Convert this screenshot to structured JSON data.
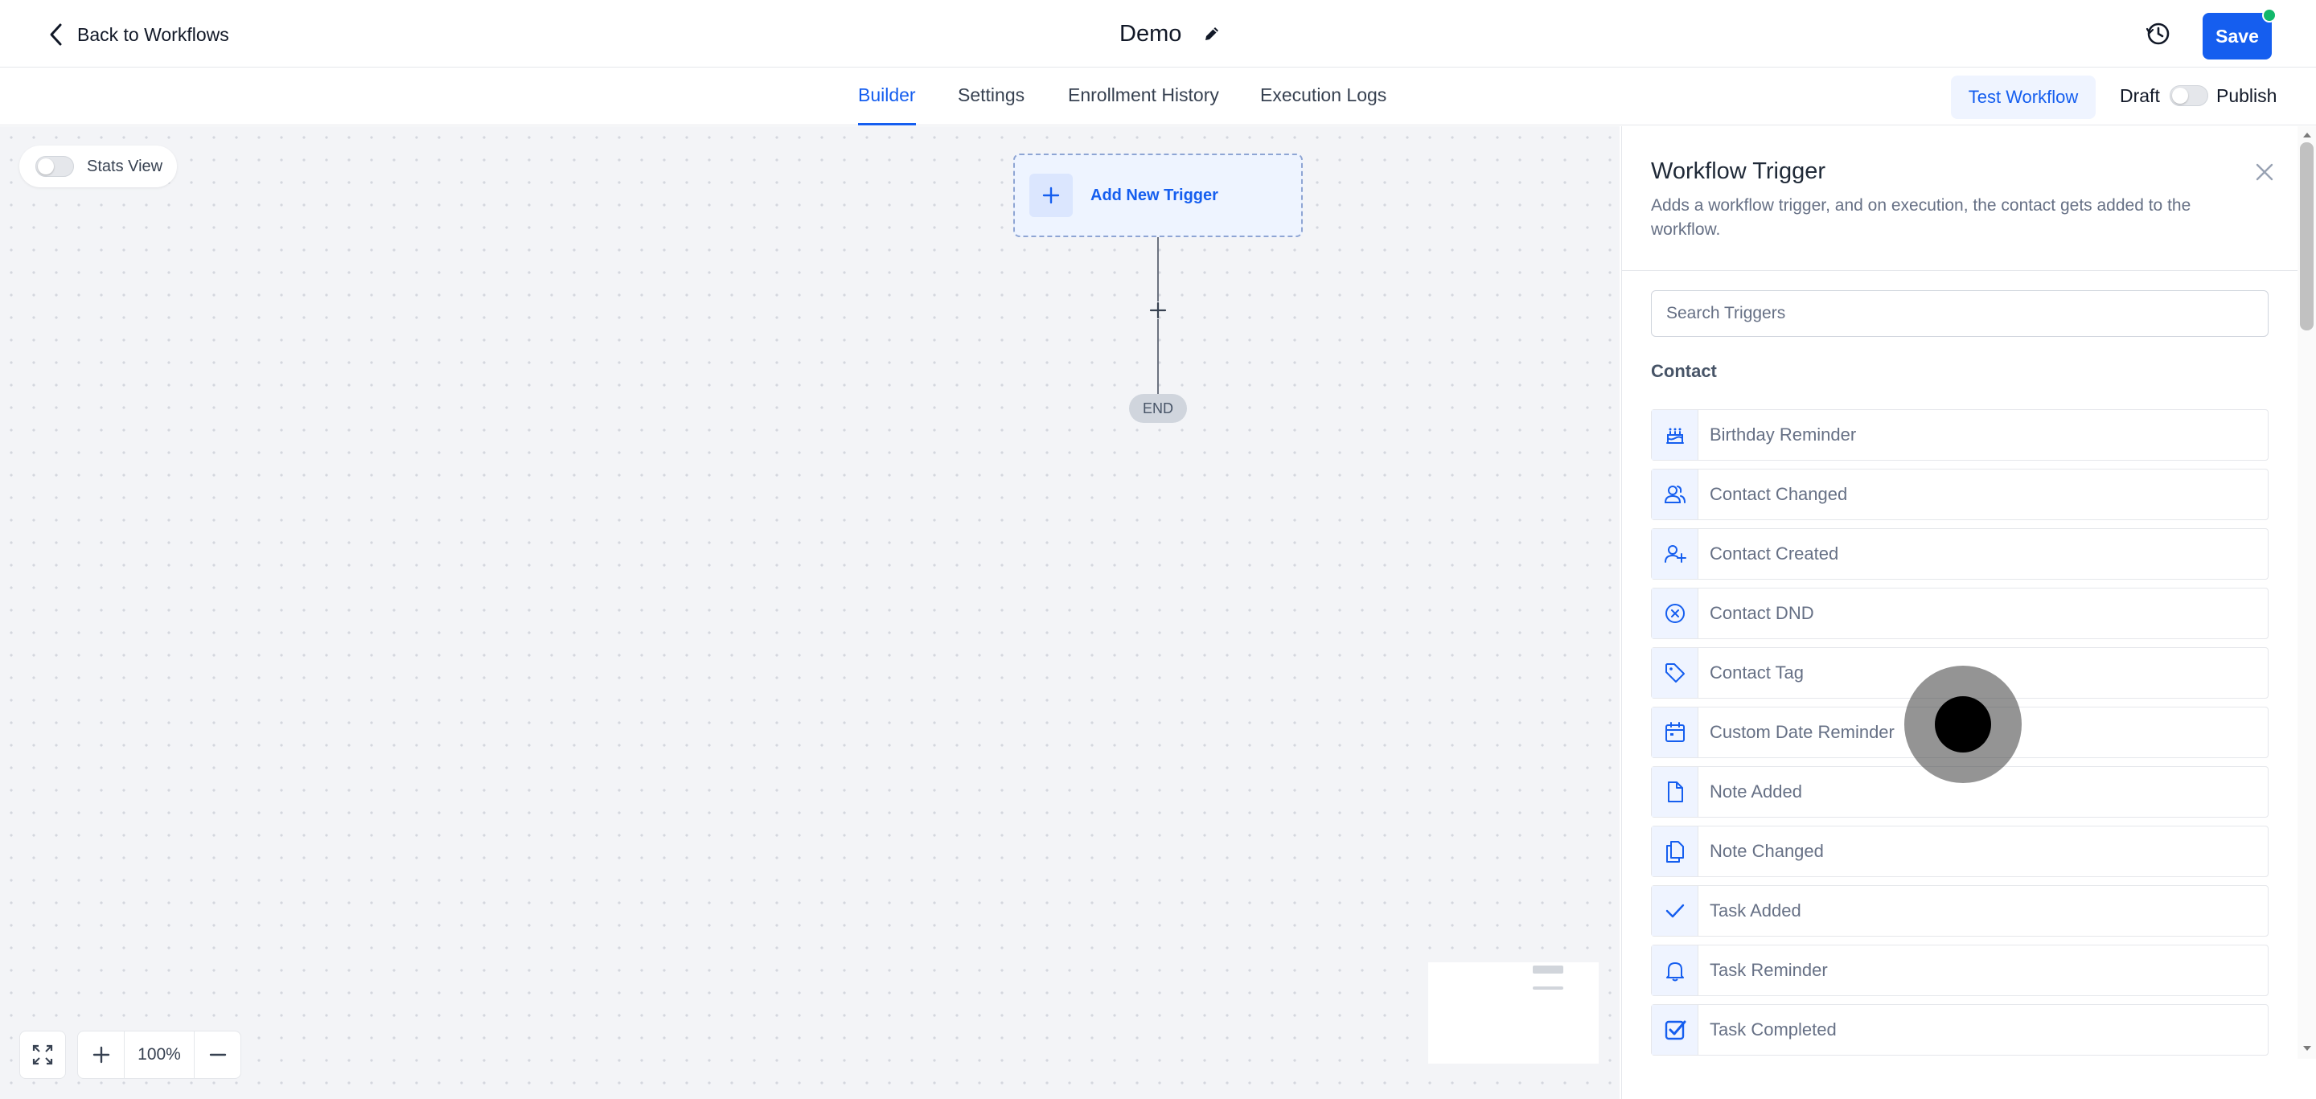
{
  "header": {
    "back_label": "Back to Workflows",
    "title": "Demo",
    "save_label": "Save"
  },
  "tabs": [
    {
      "label": "Builder",
      "active": true
    },
    {
      "label": "Settings",
      "active": false
    },
    {
      "label": "Enrollment History",
      "active": false
    },
    {
      "label": "Execution Logs",
      "active": false
    }
  ],
  "toolbar": {
    "test_label": "Test Workflow",
    "draft_label": "Draft",
    "publish_label": "Publish",
    "published": false
  },
  "canvas": {
    "stats_label": "Stats View",
    "stats_on": false,
    "add_trigger_label": "Add New Trigger",
    "end_label": "END",
    "zoom_label": "100%"
  },
  "panel": {
    "title": "Workflow Trigger",
    "description": "Adds a workflow trigger, and on execution, the contact gets added to the workflow.",
    "search_placeholder": "Search Triggers",
    "section_label": "Contact",
    "items": [
      {
        "label": "Birthday Reminder",
        "icon": "cake-icon"
      },
      {
        "label": "Contact Changed",
        "icon": "users-icon"
      },
      {
        "label": "Contact Created",
        "icon": "user-plus-icon"
      },
      {
        "label": "Contact DND",
        "icon": "x-circle-icon"
      },
      {
        "label": "Contact Tag",
        "icon": "tag-icon"
      },
      {
        "label": "Custom Date Reminder",
        "icon": "calendar-icon"
      },
      {
        "label": "Note Added",
        "icon": "file-icon"
      },
      {
        "label": "Note Changed",
        "icon": "copy-file-icon"
      },
      {
        "label": "Task Added",
        "icon": "check-icon"
      },
      {
        "label": "Task Reminder",
        "icon": "bell-icon"
      },
      {
        "label": "Task Completed",
        "icon": "check-square-icon"
      }
    ]
  },
  "colors": {
    "accent": "#155eef",
    "publish_dot": "#12b76a",
    "canvas_bg": "#f3f4f7"
  }
}
